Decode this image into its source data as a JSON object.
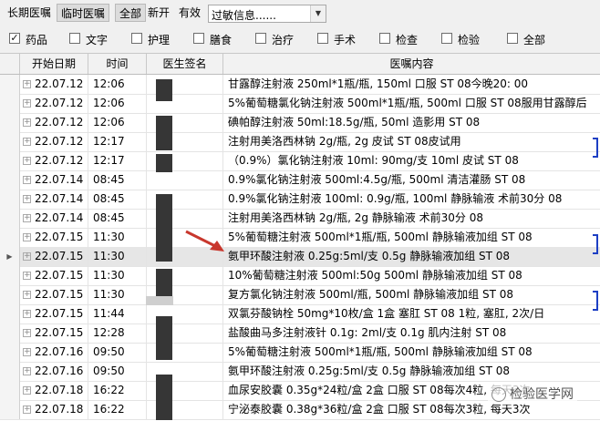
{
  "toolbar": {
    "tabs": [
      "长期医嘱",
      "临时医嘱",
      "全部",
      "新开",
      "有效"
    ],
    "select_value": "过敏信息......"
  },
  "filters": [
    {
      "label": "药品",
      "checked": true
    },
    {
      "label": "文字",
      "checked": false
    },
    {
      "label": "护理",
      "checked": false
    },
    {
      "label": "膳食",
      "checked": false
    },
    {
      "label": "治疗",
      "checked": false
    },
    {
      "label": "手术",
      "checked": false
    },
    {
      "label": "检查",
      "checked": false
    },
    {
      "label": "检验",
      "checked": false
    },
    {
      "label": "全部",
      "checked": false
    }
  ],
  "grid": {
    "columns": [
      "开始日期",
      "时间",
      "医生签名",
      "医嘱内容"
    ],
    "rows": [
      {
        "date": "22.07.12",
        "time": "12:06",
        "content": "甘露醇注射液 250ml*1瓶/瓶, 150ml 口服 ST 08今晚20: 00"
      },
      {
        "date": "22.07.12",
        "time": "12:06",
        "content": "5%葡萄糖氯化钠注射液 500ml*1瓶/瓶, 500ml 口服 ST 08服用甘露醇后"
      },
      {
        "date": "22.07.12",
        "time": "12:06",
        "content": "碘帕醇注射液 50ml:18.5g/瓶, 50ml 造影用 ST 08"
      },
      {
        "date": "22.07.12",
        "time": "12:17",
        "content": "注射用美洛西林钠 2g/瓶, 2g 皮试 ST 08皮试用"
      },
      {
        "date": "22.07.12",
        "time": "12:17",
        "content": "（0.9%）氯化钠注射液 10ml: 90mg/支 10ml 皮试 ST 08"
      },
      {
        "date": "22.07.14",
        "time": "08:45",
        "content": "0.9%氯化钠注射液 500ml:4.5g/瓶, 500ml 清洁灌肠 ST 08"
      },
      {
        "date": "22.07.14",
        "time": "08:45",
        "content": "0.9%氯化钠注射液 100ml: 0.9g/瓶, 100ml 静脉输液 术前30分 08"
      },
      {
        "date": "22.07.14",
        "time": "08:45",
        "content": "注射用美洛西林钠 2g/瓶, 2g 静脉输液 术前30分 08"
      },
      {
        "date": "22.07.15",
        "time": "11:30",
        "content": "5%葡萄糖注射液 500ml*1瓶/瓶, 500ml 静脉输液加组 ST 08"
      },
      {
        "date": "22.07.15",
        "time": "11:30",
        "content": "氨甲环酸注射液 0.25g:5ml/支 0.5g 静脉输液加组 ST 08"
      },
      {
        "date": "22.07.15",
        "time": "11:30",
        "content": "10%葡萄糖注射液 500ml:50g 500ml 静脉输液加组 ST 08"
      },
      {
        "date": "22.07.15",
        "time": "11:30",
        "content": "复方氯化钠注射液 500ml/瓶, 500ml 静脉输液加组 ST 08"
      },
      {
        "date": "22.07.15",
        "time": "11:44",
        "content": "双氯芬酸钠栓 50mg*10枚/盒 1盒 塞肛 ST 08 1粒, 塞肛, 2次/日"
      },
      {
        "date": "22.07.15",
        "time": "12:28",
        "content": "盐酸曲马多注射液针 0.1g: 2ml/支 0.1g 肌内注射 ST 08"
      },
      {
        "date": "22.07.16",
        "time": "09:50",
        "content": "5%葡萄糖注射液 500ml*1瓶/瓶, 500ml 静脉输液加组 ST 08"
      },
      {
        "date": "22.07.16",
        "time": "09:50",
        "content": "氨甲环酸注射液 0.25g:5ml/支 0.5g 静脉输液加组 ST 08"
      },
      {
        "date": "22.07.18",
        "time": "16:22",
        "content": "血尿安胶囊 0.35g*24粒/盒 2盒 口服 ST 08每次4粒, 每天3次"
      },
      {
        "date": "22.07.18",
        "time": "16:22",
        "content": "宁泌泰胶囊 0.38g*36粒/盒 2盒 口服 ST 08每次3粒, 每天3次"
      }
    ],
    "selected_row": 9
  },
  "watermark": "检验医学网",
  "colors": {
    "annotation_arrow": "#c8372d",
    "bracket": "#1d3fc4",
    "redaction": "#363636"
  }
}
